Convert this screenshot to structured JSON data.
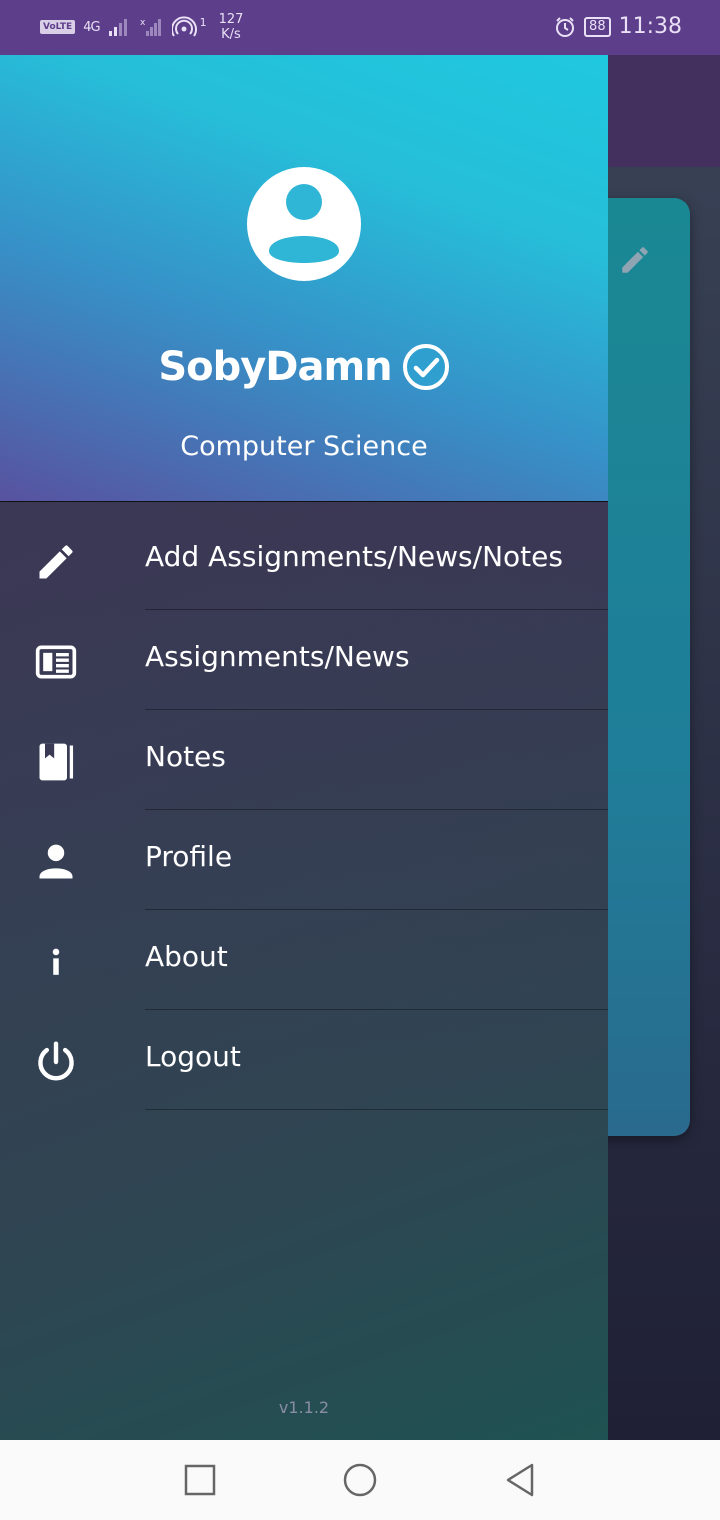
{
  "status_bar": {
    "volte": "VoLTE",
    "network": "4G",
    "hotspot_count": "1",
    "speed_value": "127",
    "speed_unit": "K/s",
    "battery": "88",
    "time": "11:38"
  },
  "drawer": {
    "user_name": "SobyDamn",
    "department": "Computer Science",
    "menu_items": [
      {
        "label": "Add Assignments/News/Notes",
        "icon": "pencil-icon"
      },
      {
        "label": "Assignments/News",
        "icon": "newspaper-icon"
      },
      {
        "label": "Notes",
        "icon": "book-icon"
      },
      {
        "label": "Profile",
        "icon": "person-icon"
      },
      {
        "label": "About",
        "icon": "info-icon"
      },
      {
        "label": "Logout",
        "icon": "power-icon"
      }
    ],
    "version": "v1.1.2"
  },
  "colors": {
    "status_bar": "#5d3e8a",
    "header_top": "#1fc8df",
    "header_bottom": "#5852a0",
    "accent_card": "#1a8893"
  }
}
